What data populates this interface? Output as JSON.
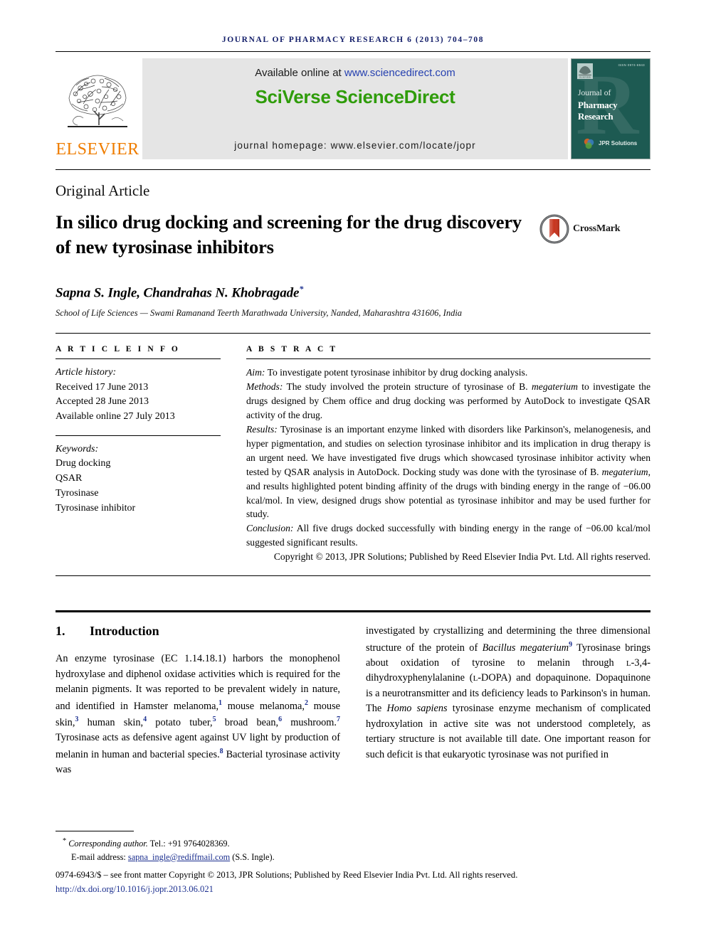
{
  "running_head": "journal of pharmacy research 6 (2013) 704–708",
  "masthead": {
    "publisher_name": "ELSEVIER",
    "available_prefix": "Available online at ",
    "available_link": "www.sciencedirect.com",
    "platform": "SciVerse ScienceDirect",
    "homepage": "journal homepage: www.elsevier.com/locate/jopr",
    "cover": {
      "issn": "ISSN 0974-6943",
      "line1": "Journal of",
      "line2": "Pharmacy Research",
      "watermark": "R",
      "publisher_mark": "JPR Solutions"
    }
  },
  "article": {
    "type": "Original Article",
    "title": "In silico drug docking and screening for the drug discovery of new tyrosinase inhibitors",
    "crossmark_label": "CrossMark",
    "authors": "Sapna S. Ingle, Chandrahas N. Khobragade",
    "author_marker": "*",
    "affiliation": "School of Life Sciences — Swami Ramanand Teerth Marathwada University, Nanded, Maharashtra 431606, India"
  },
  "article_info": {
    "heading": "A R T I C L E  I N F O",
    "history_label": "Article history:",
    "history": [
      "Received 17 June 2013",
      "Accepted 28 June 2013",
      "Available online 27 July 2013"
    ],
    "keywords_label": "Keywords:",
    "keywords": [
      "Drug docking",
      "QSAR",
      "Tyrosinase",
      "Tyrosinase inhibitor"
    ]
  },
  "abstract": {
    "heading": "A B S T R A C T",
    "aim_label": "Aim:",
    "aim_text": " To investigate potent tyrosinase inhibitor by drug docking analysis.",
    "methods_label": "Methods:",
    "methods_pre": " The study involved the protein structure of tyrosinase of B. ",
    "methods_italic": "megaterium",
    "methods_post": " to investigate the drugs designed by Chem office and drug docking was performed by AutoDock to investigate QSAR activity of the drug.",
    "results_label": "Results:",
    "results_pre": " Tyrosinase is an important enzyme linked with disorders like Parkinson's, melanogenesis, and hyper pigmentation, and studies on selection tyrosinase inhibitor and its implication in drug therapy is an urgent need. We have investigated five drugs which showcased tyrosinase inhibitor activity when tested by QSAR analysis in AutoDock. Docking study was done with the tyrosinase of B. ",
    "results_italic": "megaterium",
    "results_post": ", and results highlighted potent binding affinity of the drugs with binding energy in the range of −06.00 kcal/mol. In view, designed drugs show potential as tyrosinase inhibitor and may be used further for study.",
    "conclusion_label": "Conclusion:",
    "conclusion_text": " All five drugs docked successfully with binding energy in the range of −06.00 kcal/mol suggested significant results.",
    "copyright": "Copyright © 2013, JPR Solutions; Published by Reed Elsevier India Pvt. Ltd. All rights reserved."
  },
  "body": {
    "section_number": "1.",
    "section_title": "Introduction",
    "left_col": {
      "p1a": "An enzyme tyrosinase (EC 1.14.18.1) harbors the monophenol hydroxylase and diphenol oxidase activities which is required for the melanin pigments. It was reported to be prevalent widely in nature, and identified in Hamster melanoma,",
      "r1": "1",
      "p1b": " mouse melanoma,",
      "r2": "2",
      "p1c": " mouse skin,",
      "r3": "3",
      "p1d": " human skin,",
      "r4": "4",
      "p1e": " potato tuber,",
      "r5": "5",
      "p1f": " broad bean,",
      "r6": "6",
      "p1g": " mushroom.",
      "r7": "7",
      "p1h": " Tyrosinase acts as defensive agent against UV light by production of melanin in human and bacterial species.",
      "r8": "8",
      "p1i": " Bacterial tyrosinase activity was"
    },
    "right_col": {
      "p2a": "investigated by crystallizing and determining the three dimensional structure of the protein of ",
      "italic1": "Bacillus megaterium",
      "r9": "9",
      "p2b": " Tyrosinase brings about oxidation of tyrosine to melanin through ",
      "small1": "L",
      "p2c": "-3,4-dihydroxyphenylalanine (",
      "small2": "L",
      "p2d": "-DOPA) and dopaquinone. Dopaquinone is a neurotransmitter and its deficiency leads to Parkinson's in human. The ",
      "italic2": "Homo sapiens",
      "p2e": " tyrosinase enzyme mechanism of complicated hydroxylation in active site was not understood completely, as tertiary structure is not available till date. One important reason for such deficit is that eukaryotic tyrosinase was not purified in"
    }
  },
  "footer": {
    "corresponding_label": "Corresponding author.",
    "corresponding_tel": " Tel.: +91 9764028369.",
    "email_label": "E-mail address: ",
    "email": "sapna_ingle@rediffmail.com",
    "email_suffix": " (S.S. Ingle).",
    "issn_line": "0974-6943/$ – see front matter Copyright © 2013, JPR Solutions; Published by Reed Elsevier India Pvt. Ltd. All rights reserved.",
    "doi": "http://dx.doi.org/10.1016/j.jopr.2013.06.021"
  },
  "colors": {
    "runhead": "#15206b",
    "elsevier_orange": "#ef7d00",
    "sciencedirect_green": "#2f9c0a",
    "link_blue": "#2641b0",
    "ref_blue": "#1b2f8f",
    "cover_teal": "#1d5a52",
    "masthead_gray": "#e5e5e5"
  }
}
